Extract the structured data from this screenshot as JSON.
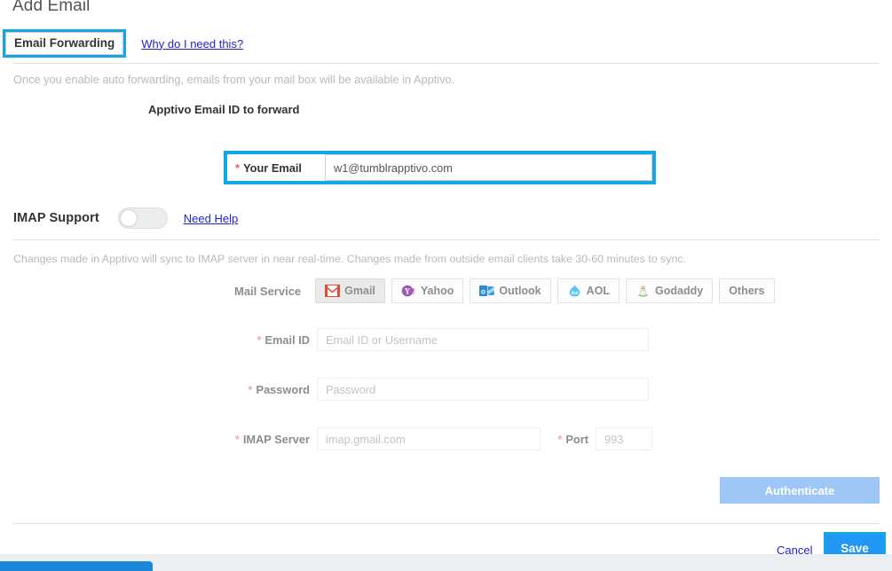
{
  "page": {
    "title": "Add Email"
  },
  "tabs": {
    "active_tab_label": "Email Forwarding",
    "why_link_label": "Why do I need this?"
  },
  "forwarding": {
    "description": "Once you enable auto forwarding, emails from your mail box will be available in Apptivo.",
    "section_heading": "Apptivo Email ID to forward",
    "your_email_label": "Your Email",
    "your_email_value": "w1@tumblrapptivo.com",
    "required_marker": "*"
  },
  "imap": {
    "support_label": "IMAP Support",
    "toggle_state": "off",
    "need_help_label": "Need Help",
    "sync_note": "Changes made in Apptivo will sync to IMAP server in near real-time. Changes made from outside email clients take 30-60 minutes to sync.",
    "mail_service_label": "Mail Service",
    "mail_services": [
      {
        "label": "Gmail",
        "icon": "gmail-icon",
        "selected": true
      },
      {
        "label": "Yahoo",
        "icon": "yahoo-icon",
        "selected": false
      },
      {
        "label": "Outlook",
        "icon": "outlook-icon",
        "selected": false
      },
      {
        "label": "AOL",
        "icon": "aol-icon",
        "selected": false
      },
      {
        "label": "Godaddy",
        "icon": "godaddy-icon",
        "selected": false
      },
      {
        "label": "Others",
        "icon": "",
        "selected": false
      }
    ],
    "fields": {
      "email_id_label": "Email ID",
      "email_id_placeholder": "Email ID or Username",
      "email_id_value": "",
      "password_label": "Password",
      "password_placeholder": "Password",
      "password_value": "",
      "imap_server_label": "IMAP Server",
      "imap_server_placeholder": "imap.gmail.com",
      "imap_server_value": "",
      "port_label": "Port",
      "port_placeholder": "993",
      "port_value": ""
    },
    "authenticate_label": "Authenticate"
  },
  "footer": {
    "cancel_label": "Cancel",
    "save_label": "Save"
  },
  "colors": {
    "focus_ring": "#13a7e8",
    "save_blue": "#2196f3",
    "authenticate_blue": "#9ec7f5",
    "link_blue": "#2222cc",
    "required_red": "#f06060",
    "bottom_bar_blue": "#1c87d8"
  }
}
